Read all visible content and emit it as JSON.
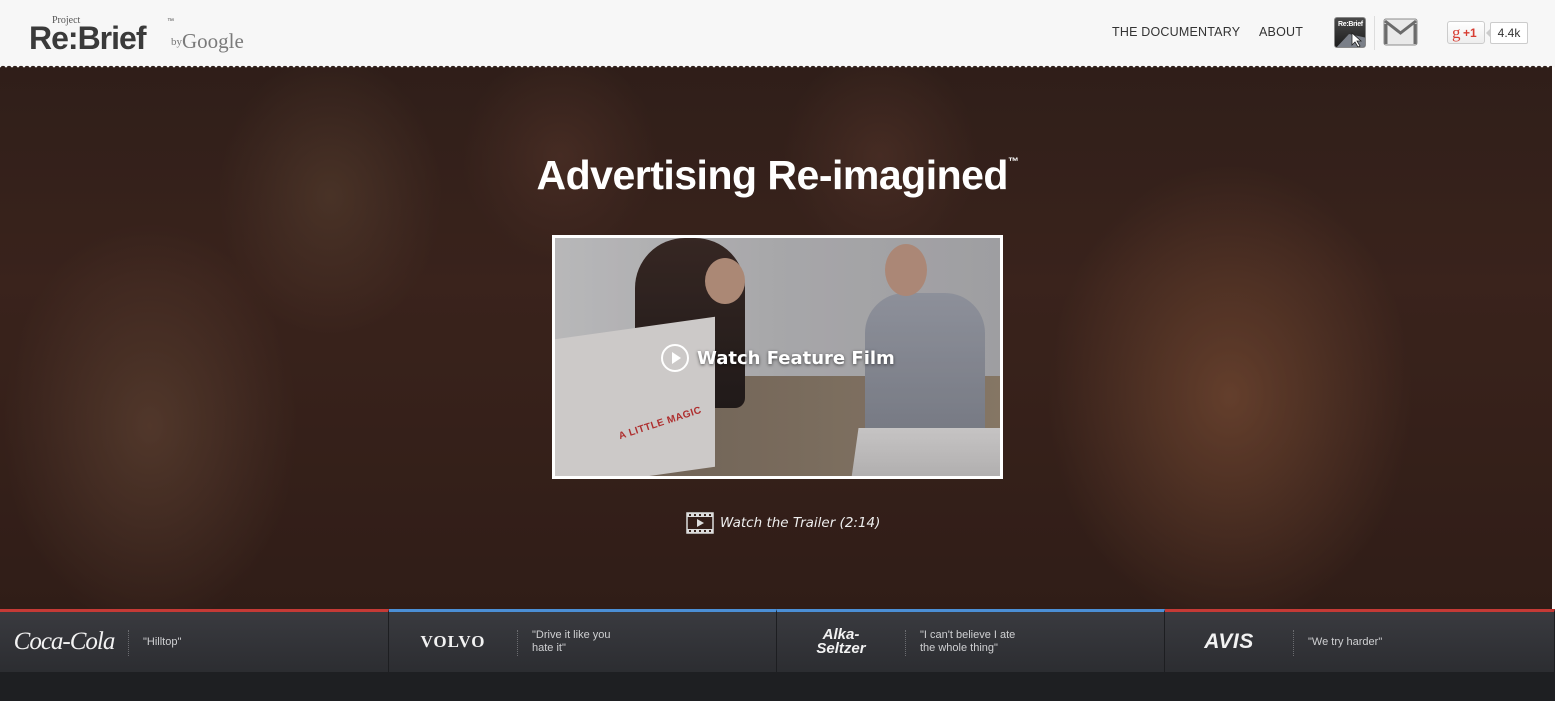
{
  "header": {
    "logo": {
      "project": "Project",
      "title": "Re:Brief",
      "trademark": "™",
      "by": "by",
      "google": "Google"
    },
    "nav": {
      "documentary": "THE DOCUMENTARY",
      "about": "ABOUT"
    },
    "app_icon_label": "Re:Brief",
    "gplus": {
      "g": "g",
      "plus_one": "+1",
      "count": "4.4k"
    }
  },
  "hero": {
    "headline": "Advertising Re-imagined",
    "headline_tm": "™",
    "video": {
      "poster_text": "A LITTLE MAGIC",
      "watch_label": "Watch Feature Film"
    },
    "trailer_label": "Watch the Trailer (2:14)"
  },
  "campaigns": [
    {
      "brand": "Coca-Cola",
      "quote": "\"Hilltop\"",
      "accent": "#c53a36"
    },
    {
      "brand": "VOLVO",
      "quote": "\"Drive it like you hate it\"",
      "accent": "#4b8fd6"
    },
    {
      "brand_line1": "Alka-",
      "brand_line2": "Seltzer",
      "quote": "\"I can't believe I ate the whole thing\"",
      "accent": "#4b8fd6"
    },
    {
      "brand": "AVIS",
      "quote": "\"We try harder\"",
      "accent": "#c53a36"
    }
  ]
}
